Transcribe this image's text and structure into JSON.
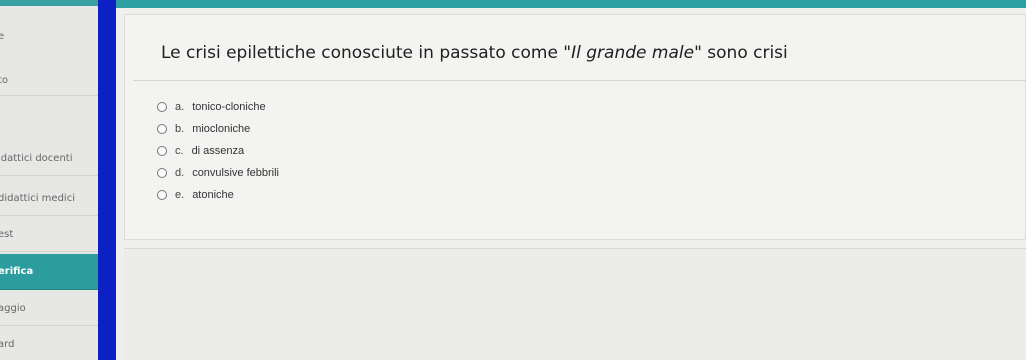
{
  "sidebar": {
    "items": [
      {
        "label": "e"
      },
      {
        "label": "to"
      },
      {
        "label": "idattici docenti"
      },
      {
        "label": "didattici medici"
      },
      {
        "label": "est"
      },
      {
        "label": "erifica"
      },
      {
        "label": "aggio"
      },
      {
        "label": "ard"
      }
    ]
  },
  "question": {
    "prefix": "Le crisi epilettiche conosciute in passato come \"",
    "emphasis": "Il grande male",
    "suffix": "\" sono crisi",
    "options": [
      {
        "letter": "a.",
        "text": "tonico-cloniche"
      },
      {
        "letter": "b.",
        "text": "miocloniche"
      },
      {
        "letter": "c.",
        "text": "di assenza"
      },
      {
        "letter": "d.",
        "text": "convulsive febbrili"
      },
      {
        "letter": "e.",
        "text": "atoniche"
      }
    ]
  },
  "colors": {
    "accent": "#2d9c9e",
    "blue_strip": "#0c20c4"
  }
}
